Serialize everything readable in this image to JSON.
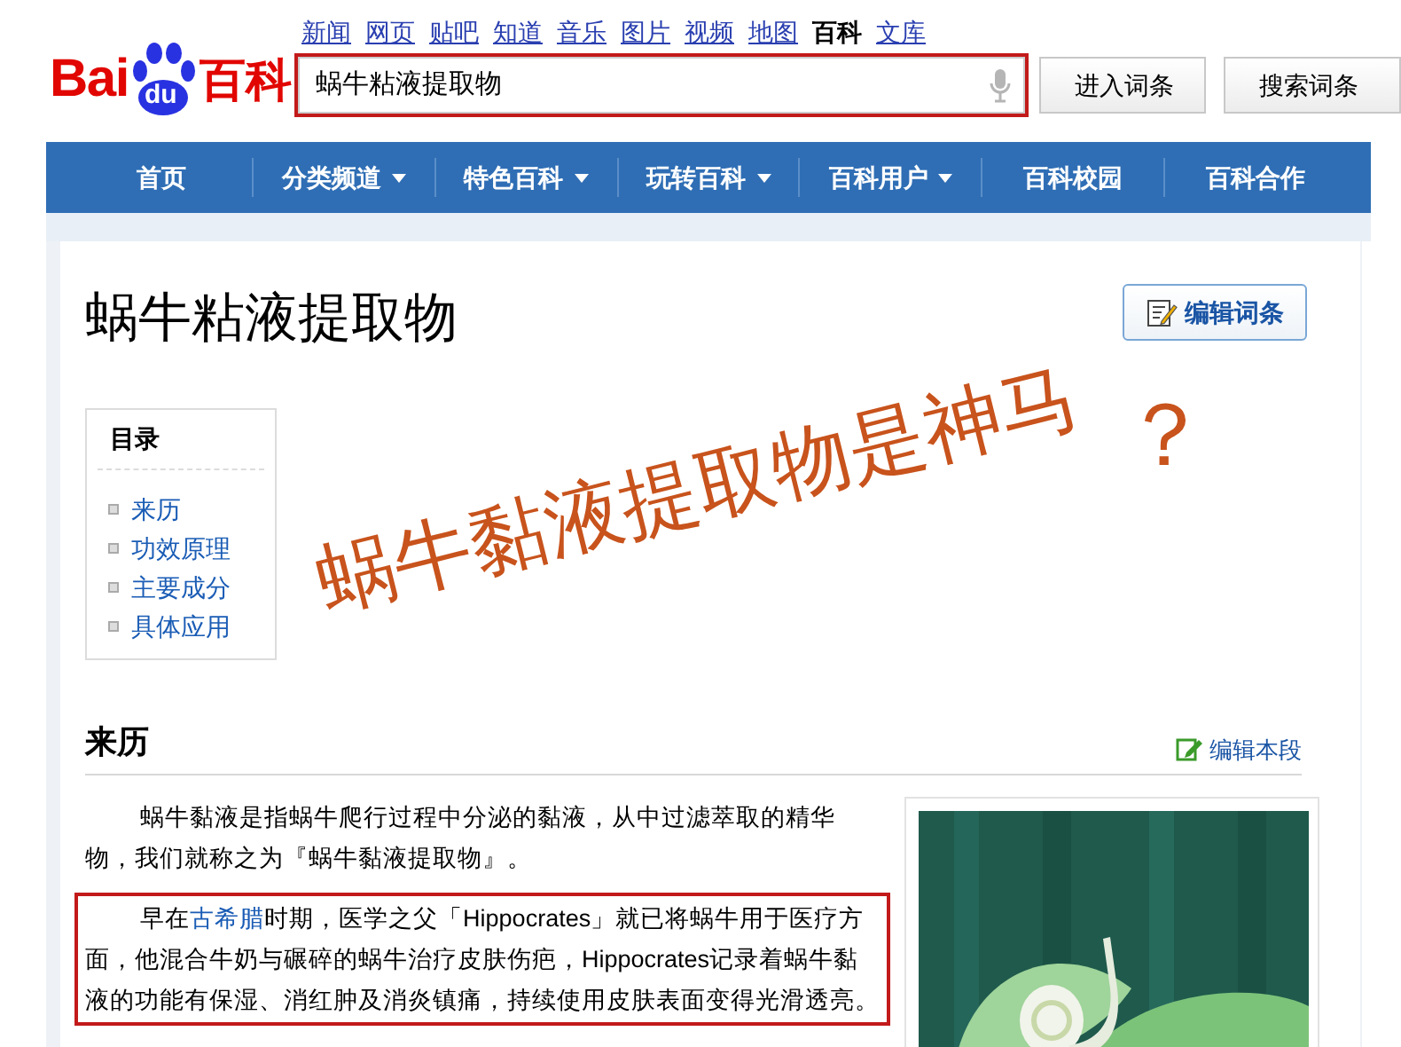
{
  "top_links": [
    {
      "label": "新闻",
      "selected": false
    },
    {
      "label": "网页",
      "selected": false
    },
    {
      "label": "贴吧",
      "selected": false
    },
    {
      "label": "知道",
      "selected": false
    },
    {
      "label": "音乐",
      "selected": false
    },
    {
      "label": "图片",
      "selected": false
    },
    {
      "label": "视频",
      "selected": false
    },
    {
      "label": "地图",
      "selected": false
    },
    {
      "label": "百科",
      "selected": true
    },
    {
      "label": "文库",
      "selected": false
    }
  ],
  "logo": {
    "text_left": "Bai",
    "text_paw": "du",
    "text_right": "百科"
  },
  "search": {
    "value": "蜗牛粘液提取物",
    "highlighted": true
  },
  "buttons": [
    "进入词条",
    "搜索词条"
  ],
  "nav": [
    {
      "label": "首页",
      "dropdown": false
    },
    {
      "label": "分类频道",
      "dropdown": true
    },
    {
      "label": "特色百科",
      "dropdown": true
    },
    {
      "label": "玩转百科",
      "dropdown": true
    },
    {
      "label": "百科用户",
      "dropdown": true
    },
    {
      "label": "百科校园",
      "dropdown": false
    },
    {
      "label": "百科合作",
      "dropdown": false
    }
  ],
  "article": {
    "title": "蜗牛粘液提取物",
    "edit_button": "编辑词条"
  },
  "toc": {
    "heading": "目录",
    "items": [
      "来历",
      "功效原理",
      "主要成分",
      "具体应用"
    ]
  },
  "section": {
    "heading": "来历",
    "edit_link": "编辑本段",
    "paragraphs": [
      {
        "highlighted": false,
        "segments": [
          {
            "text": "蜗牛黏液是指蜗牛爬行过程中分泌的黏液，从中过滤萃取的精华物，我们就称之为『蜗牛黏液提取物』。",
            "link": false
          }
        ]
      },
      {
        "highlighted": true,
        "segments": [
          {
            "text": "早在",
            "link": false
          },
          {
            "text": "古希腊",
            "link": true
          },
          {
            "text": "时期，医学之父「Hippocrates」就已将蜗牛用于医疗方面，他混合牛奶与碾碎的蜗牛治疗皮肤伤疤，Hippocrates记录着蜗牛黏液的功能有保湿、消红肿及消炎镇痛，持续使用皮肤表面变得光滑透亮。",
            "link": false
          }
        ]
      }
    ]
  },
  "image": {
    "kind": "picture"
  },
  "annotation": {
    "text": "蜗牛黏液提取物是神马",
    "mark": "？"
  }
}
